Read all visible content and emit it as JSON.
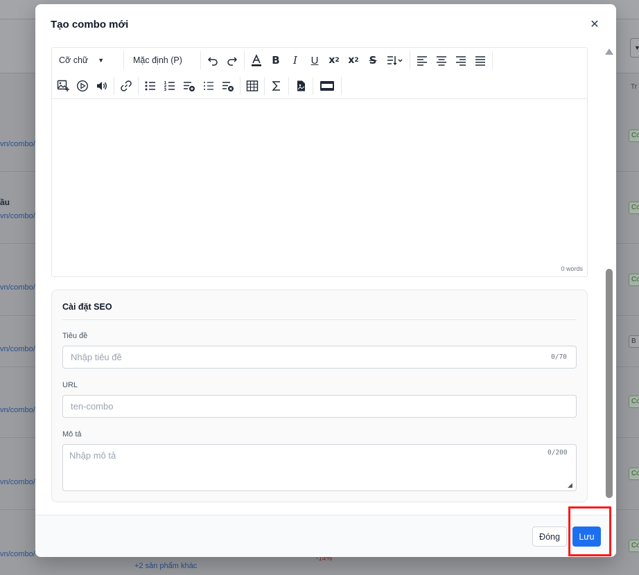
{
  "background": {
    "link_text": "vn/combo/",
    "title_fragment": "ầu",
    "badge_text": "Co",
    "badge_gray_text": "B",
    "more_products": "+2 sản phẩm khác",
    "discount": "-14%",
    "table_header_fragment": "Tr"
  },
  "modal": {
    "title": "Tạo combo mới",
    "close_icon": "close-icon"
  },
  "editor": {
    "font_size_label": "Cỡ chữ",
    "paragraph_label": "Mặc định (P)",
    "word_count": "0 words",
    "toolbar_row1": [
      "undo-icon",
      "redo-icon",
      "font-color-icon",
      "bold-icon",
      "italic-icon",
      "underline-icon",
      "subscript-icon",
      "superscript-icon",
      "strikethrough-icon",
      "line-height-icon",
      "align-left-icon",
      "align-center-icon",
      "align-right-icon",
      "align-justify-icon"
    ],
    "toolbar_row2": [
      "image-icon",
      "video-icon",
      "audio-icon",
      "link-icon",
      "bullet-list-icon",
      "numbered-list-icon",
      "checklist-add-icon",
      "list-outline-icon",
      "checklist-remove-icon",
      "table-icon",
      "formula-icon",
      "file-icon",
      "embed-icon"
    ]
  },
  "seo": {
    "section_title": "Cài đặt SEO",
    "title_label": "Tiêu đề",
    "title_placeholder": "Nhập tiêu đề",
    "title_counter": "0/70",
    "url_label": "URL",
    "url_placeholder": "ten-combo",
    "desc_label": "Mô tả",
    "desc_placeholder": "Nhập mô tả",
    "desc_counter": "0/200"
  },
  "footer": {
    "close_label": "Đóng",
    "save_label": "Lưu"
  },
  "colors": {
    "primary": "#1d6ff2",
    "highlight": "#ff1a1a"
  }
}
